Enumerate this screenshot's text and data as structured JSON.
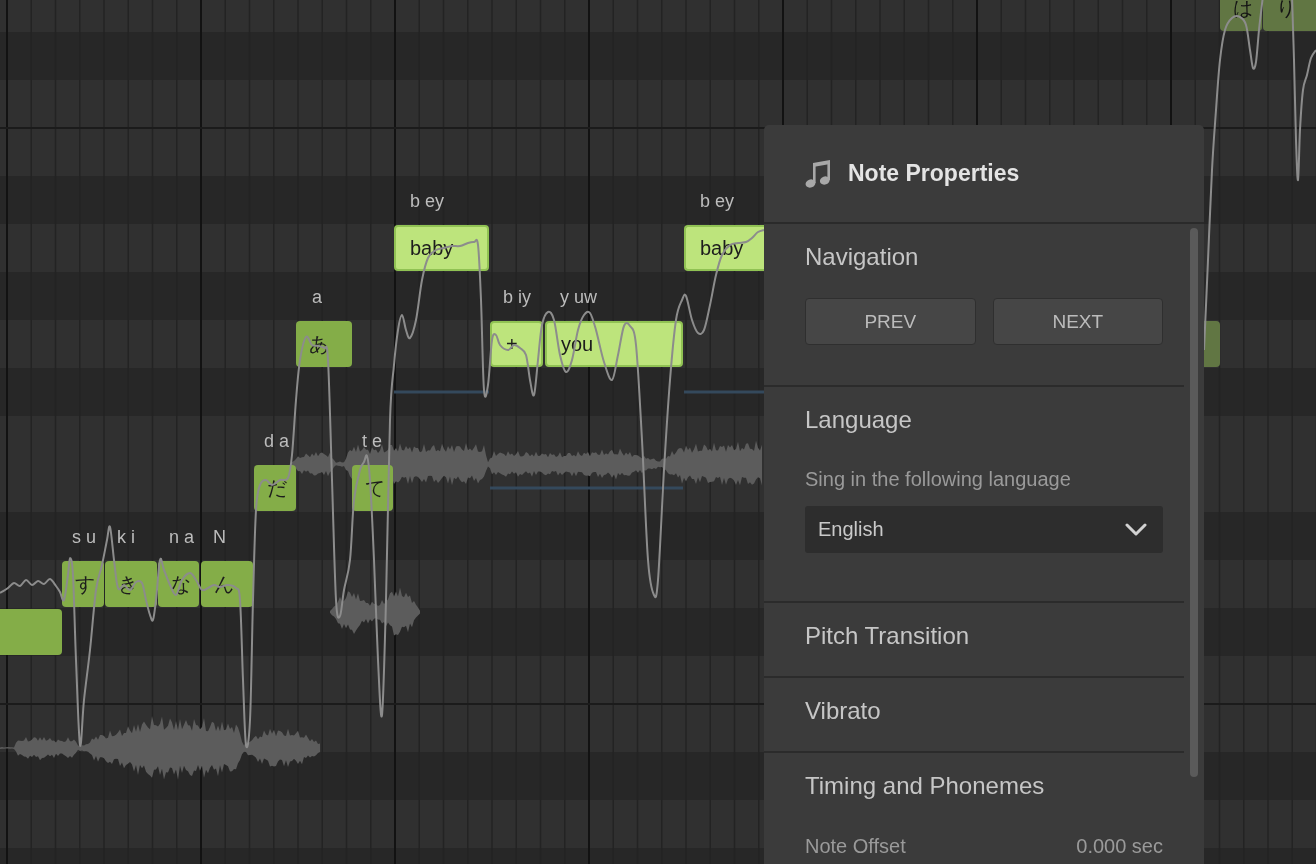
{
  "piano_roll": {
    "notes": [
      {
        "selected": false,
        "dimmed": false
      },
      {
        "lyric": "す",
        "phonemes": "s u",
        "selected": false,
        "dimmed": false
      },
      {
        "lyric": "き",
        "phonemes": "k i",
        "selected": false,
        "dimmed": false
      },
      {
        "lyric": "な",
        "phonemes": "n a",
        "selected": false,
        "dimmed": false
      },
      {
        "lyric": "ん",
        "phonemes": "N",
        "selected": false,
        "dimmed": false
      },
      {
        "lyric": "だ",
        "phonemes": "d a",
        "selected": false,
        "dimmed": false
      },
      {
        "lyric": "あ",
        "phonemes": "a",
        "selected": false,
        "dimmed": false
      },
      {
        "lyric": "て",
        "phonemes": "t e",
        "selected": false,
        "dimmed": false
      },
      {
        "lyric": "baby",
        "phonemes": "b ey",
        "selected": true,
        "dimmed": false
      },
      {
        "lyric": "+",
        "phonemes": "b iy",
        "selected": true,
        "dimmed": false
      },
      {
        "lyric": "you",
        "phonemes": "y uw",
        "selected": true,
        "dimmed": false
      },
      {
        "lyric": "baby",
        "phonemes": "b ey",
        "selected": true,
        "dimmed": false
      },
      {
        "selected": false,
        "dimmed": true
      },
      {
        "lyric": "は",
        "selected": false,
        "dimmed": true
      },
      {
        "lyric": "り",
        "selected": false,
        "dimmed": true
      }
    ]
  },
  "note_properties": {
    "title": "Note Properties",
    "sections": [
      {
        "kind": "navigation",
        "title": "Navigation",
        "buttons": [
          "PREV",
          "NEXT"
        ]
      },
      {
        "kind": "language",
        "title": "Language",
        "hint": "Sing in the following language",
        "dropdown": {
          "value": "English"
        }
      },
      {
        "kind": "collapsed",
        "title": "Pitch Transition"
      },
      {
        "kind": "collapsed",
        "title": "Vibrato"
      },
      {
        "kind": "timing",
        "title": "Timing and Phonemes",
        "fields": [
          {
            "label": "Note Offset",
            "value": "0.000 sec"
          }
        ]
      }
    ]
  }
}
